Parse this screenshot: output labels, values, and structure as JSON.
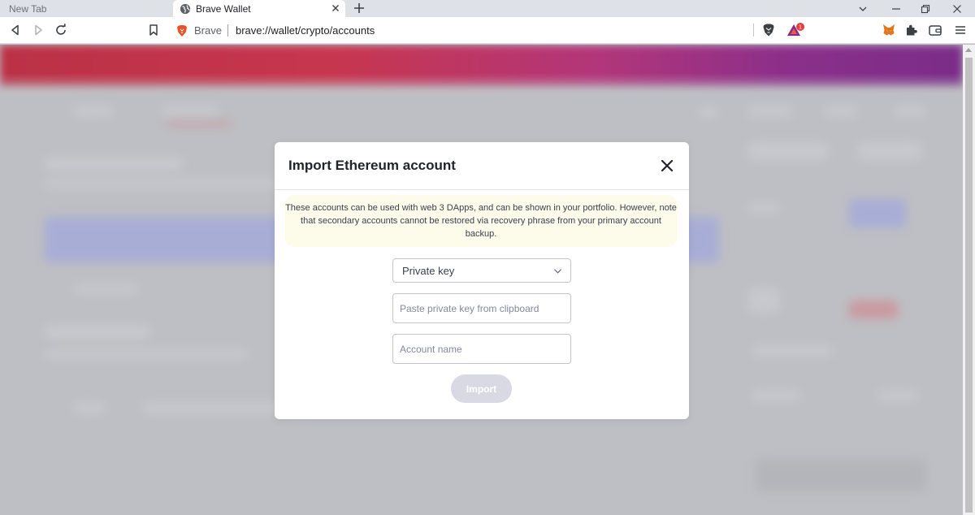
{
  "browser": {
    "tabs": [
      {
        "title": "New Tab",
        "active": false
      },
      {
        "title": "Brave Wallet",
        "active": true
      }
    ],
    "omnibox": {
      "label": "Brave",
      "url": "brave://wallet/crypto/accounts"
    },
    "rewards_badge_count": "1"
  },
  "modal": {
    "title": "Import Ethereum account",
    "warning": "These accounts can be used with web 3 DApps, and can be shown in your portfolio. However, note that secondary accounts cannot be restored via recovery phrase from your primary account backup.",
    "import_type": {
      "selected": "Private key"
    },
    "private_key_field": {
      "value": "",
      "placeholder": "Paste private key from clipboard"
    },
    "account_name_field": {
      "value": "",
      "placeholder": "Account name"
    },
    "import_button_label": "Import",
    "import_button_disabled": true
  },
  "colors": {
    "hero_start": "#bb3146",
    "hero_end": "#7a2d88",
    "overlay": "#bebfc4",
    "warning_bg": "#fdfbea",
    "button_disabled": "#d8d9e3"
  }
}
